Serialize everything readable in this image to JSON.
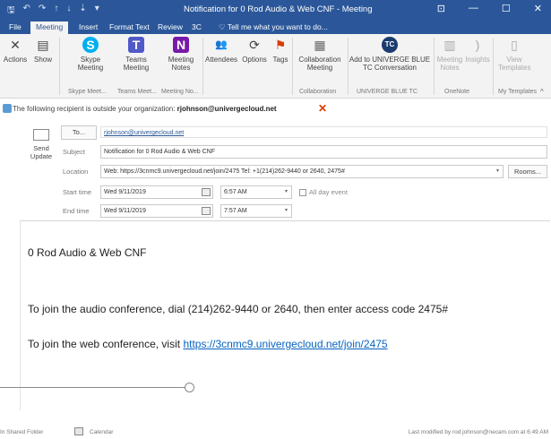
{
  "window": {
    "title": "Notification for 0 Rod Audio & Web CNF - Meeting",
    "controls": [
      "⊡",
      "—",
      "☐",
      "✕"
    ]
  },
  "qat": [
    "🖫",
    "↶",
    "↷",
    "↑",
    "↓",
    "⇣",
    "▾"
  ],
  "tabs": [
    "File",
    "Meeting",
    "Insert",
    "Format Text",
    "Review",
    "3C",
    "Tell me what you want to do..."
  ],
  "ribbon": {
    "buttons": [
      {
        "label": "Actions",
        "icon": "✕"
      },
      {
        "label": "Show",
        "icon": "▤"
      },
      {
        "label": "Skype Meeting",
        "icon": "S"
      },
      {
        "label": "Teams Meeting",
        "icon": "T"
      },
      {
        "label": "Meeting Notes",
        "icon": "N"
      },
      {
        "label": "Attendees",
        "icon": "👥"
      },
      {
        "label": "Options",
        "icon": "⟳"
      },
      {
        "label": "Tags",
        "icon": "⚑"
      },
      {
        "label": "Collaboration Meeting",
        "icon": "▦"
      },
      {
        "label": "Add to UNIVERGE BLUE TC Conversation",
        "icon": "TC"
      },
      {
        "label": "Meeting Notes",
        "icon": "▥"
      },
      {
        "label": "Insights",
        "icon": ")"
      },
      {
        "label": "View Templates",
        "icon": "▯"
      }
    ],
    "groups": [
      "Skype Meet...",
      "Teams Meet...",
      "Meeting No...",
      "Collaboration",
      "UNIVERGE BLUE TC",
      "OneNote",
      "My Templates"
    ]
  },
  "info": {
    "prefix": "The following recipient is outside your organization: ",
    "email": "rjohnson@univergecloud.net"
  },
  "form": {
    "send_label": "Send Update",
    "to_label": "To...",
    "to_value": "rjohnson@univergecloud.net",
    "subject_label": "Subject",
    "subject_value": "Notification for 0 Rod Audio & Web CNF",
    "location_label": "Location",
    "location_value": "Web: https://3cnmc9.univergecloud.net/join/2475 Tel: +1(214)262-9440 or 2640, 2475#",
    "rooms_label": "Rooms...",
    "start_label": "Start time",
    "start_date": "Wed 9/11/2019",
    "start_time": "6:57 AM",
    "all_day_label": "All day event",
    "end_label": "End time",
    "end_date": "Wed 9/11/2019",
    "end_time": "7:57 AM"
  },
  "body": {
    "heading": "0 Rod Audio & Web CNF",
    "audio": "To join the audio conference, dial (214)262-9440 or 2640, then enter access code 2475#",
    "web_prefix": "To join the web conference, visit ",
    "web_link": "https://3cnmc9.univergecloud.net/join/2475"
  },
  "status": {
    "folder": "In Shared Folder",
    "calendar": "Calendar",
    "modified": "Last modified by rod.johnson@necam.com at 6:49 AM"
  }
}
